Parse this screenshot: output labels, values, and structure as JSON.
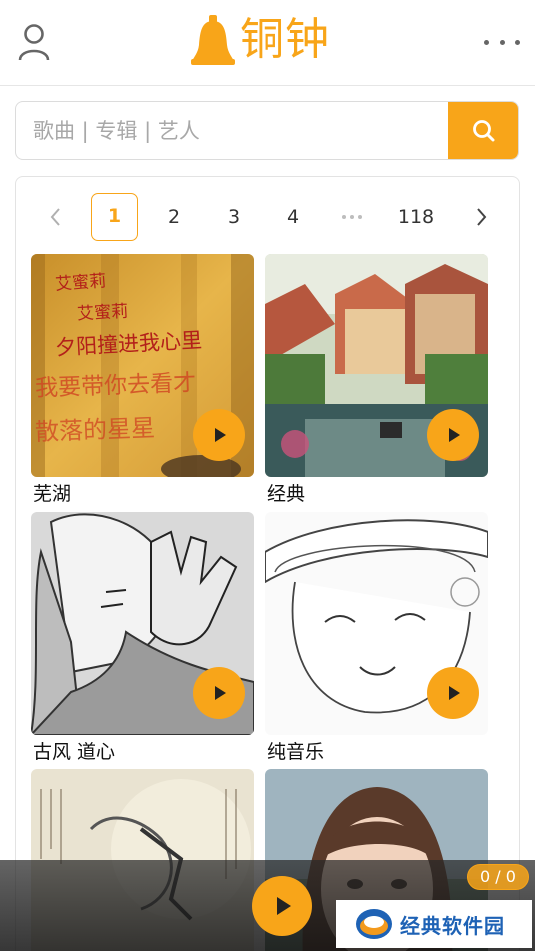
{
  "header": {
    "logo_text": "铜钟",
    "user_icon": "user-icon",
    "more_icon": "more-horizontal-icon",
    "brand_color": "#f8a519"
  },
  "search": {
    "placeholder": "歌曲 | 专辑 | 艺人",
    "value": "",
    "button_icon": "search-icon"
  },
  "pagination": {
    "prev_icon": "chevron-left-icon",
    "next_icon": "chevron-right-icon",
    "pages": [
      "1",
      "2",
      "3",
      "4"
    ],
    "current": "1",
    "last": "118",
    "ellipsis_icon": "ellipsis-icon"
  },
  "playlists": [
    {
      "title": "芜湖",
      "image": "yellow-wall-handwritten-chinese-text",
      "image_text": [
        "艾蜜莉",
        "艾蜜莉",
        "夕阳撞进我心里",
        "我要带你去看才",
        "散落的星星"
      ]
    },
    {
      "title": "经典",
      "image": "canal-village-painting"
    },
    {
      "title": "古风 道心",
      "image": "manga-girl-hand-over-face"
    },
    {
      "title": "纯音乐",
      "image": "sketch-girl-with-hat"
    },
    {
      "title": "",
      "image": "ink-painting-dancer-calligraphy"
    },
    {
      "title": "",
      "image": "photo-young-woman-bangs"
    }
  ],
  "player": {
    "play_icon": "play-icon",
    "counter": "0 / 0"
  },
  "watermark": {
    "text": "经典软件园",
    "icon": "watermark-logo-icon"
  }
}
